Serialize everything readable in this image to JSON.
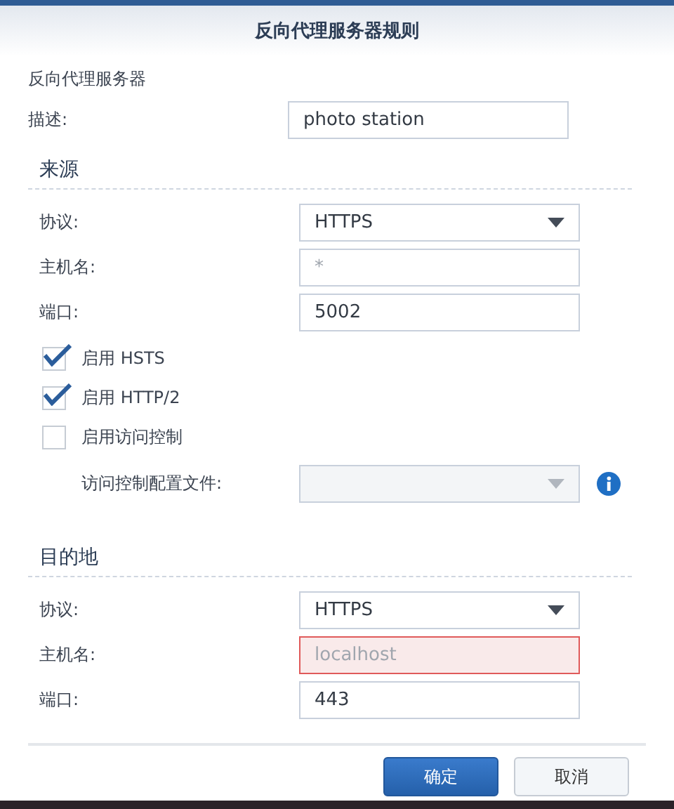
{
  "dialog": {
    "title": "反向代理服务器规则"
  },
  "section_label": "反向代理服务器",
  "description": {
    "label": "描述:",
    "value": "photo station"
  },
  "source": {
    "title": "来源",
    "fields": [
      {
        "kind": "select",
        "label": "协议:",
        "value": "HTTPS",
        "error": false
      },
      {
        "kind": "text",
        "label": "主机名:",
        "placeholder": "*",
        "error": false
      },
      {
        "kind": "text",
        "label": "端口:",
        "value": "5002",
        "error": false
      }
    ],
    "checkboxes": [
      {
        "label": "启用 HSTS",
        "checked": true
      },
      {
        "label": "启用 HTTP/2",
        "checked": true
      },
      {
        "label": "启用访问控制",
        "checked": false
      }
    ],
    "profile": {
      "kind": "select",
      "label": "访问控制配置文件:",
      "disabled": true,
      "error": false
    }
  },
  "destination": {
    "title": "目的地",
    "fields": [
      {
        "kind": "select",
        "label": "协议:",
        "value": "HTTPS",
        "error": false
      },
      {
        "kind": "text",
        "label": "主机名:",
        "placeholder": "localhost",
        "error": true
      },
      {
        "kind": "text",
        "label": "端口:",
        "value": "443",
        "error": false
      }
    ]
  },
  "buttons": [
    {
      "label": "确定",
      "kind": "primary"
    },
    {
      "label": "取消",
      "kind": "secondary"
    }
  ]
}
